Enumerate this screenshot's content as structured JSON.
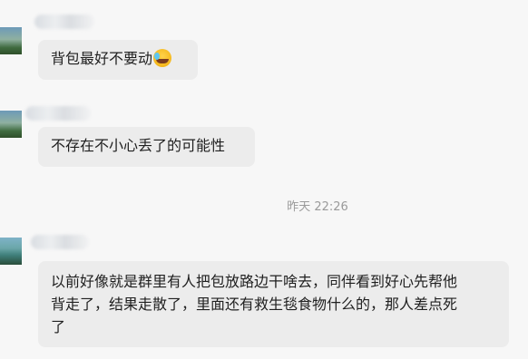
{
  "messages": [
    {
      "text": "背包最好不要动",
      "emoji": "laughing-crying-emoji"
    },
    {
      "text": "不存在不小心丢了的可能性"
    },
    {
      "lines": [
        "以前好像就是群里有人把包放路边干啥去，同伴看到好心先帮他",
        "背走了，结果走散了，里面还有救生毯食物什么的，那人差点死",
        "了"
      ]
    }
  ],
  "divider": {
    "time": "昨天 22:26"
  }
}
